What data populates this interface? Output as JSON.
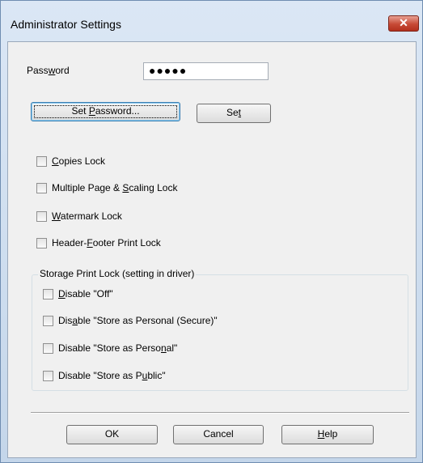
{
  "window": {
    "title": "Administrator Settings",
    "close_glyph": "✕"
  },
  "password": {
    "label_pre": "Pass",
    "label_ul": "w",
    "label_post": "ord",
    "masked_value": "●●●●●"
  },
  "buttons": {
    "set_password": {
      "pre": "Set ",
      "ul": "P",
      "post": "assword..."
    },
    "set": {
      "pre": "Se",
      "ul": "t",
      "post": ""
    },
    "ok": "OK",
    "cancel": "Cancel",
    "help": {
      "pre": "",
      "ul": "H",
      "post": "elp"
    }
  },
  "locks": [
    {
      "pre": "",
      "ul": "C",
      "post": "opies Lock",
      "checked": false
    },
    {
      "pre": "Multiple Page & ",
      "ul": "S",
      "post": "caling Lock",
      "checked": false
    },
    {
      "pre": "",
      "ul": "W",
      "post": "atermark Lock",
      "checked": false
    },
    {
      "pre": "Header-",
      "ul": "F",
      "post": "ooter Print Lock",
      "checked": false
    }
  ],
  "storage_group": {
    "legend": "Storage Print Lock (setting in driver)",
    "items": [
      {
        "pre": "",
        "ul": "D",
        "post": "isable \"Off\"",
        "checked": false
      },
      {
        "pre": "Dis",
        "ul": "a",
        "post": "ble \"Store as Personal (Secure)\"",
        "checked": false
      },
      {
        "pre": "Disable \"Store as Perso",
        "ul": "n",
        "post": "al\"",
        "checked": false
      },
      {
        "pre": "Disable \"Store as P",
        "ul": "u",
        "post": "blic\"",
        "checked": false
      }
    ]
  }
}
